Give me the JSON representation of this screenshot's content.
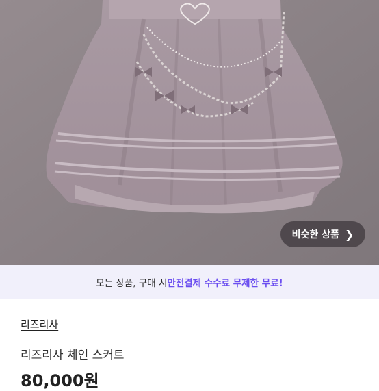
{
  "photo": {
    "similar_button_label": "비슷한 상품",
    "similar_button_icon": "chevron-right-icon"
  },
  "banner": {
    "prefix": "모든 상품, 구매 시 ",
    "highlight": "안전결제 수수료 무제한 무료!"
  },
  "product": {
    "shop_name": "리즈리사",
    "title": "리즈리사 체인 스커트",
    "price": "80,000원"
  },
  "colors": {
    "accent": "#6b4ef0",
    "banner_bg": "#f1f0fb"
  }
}
